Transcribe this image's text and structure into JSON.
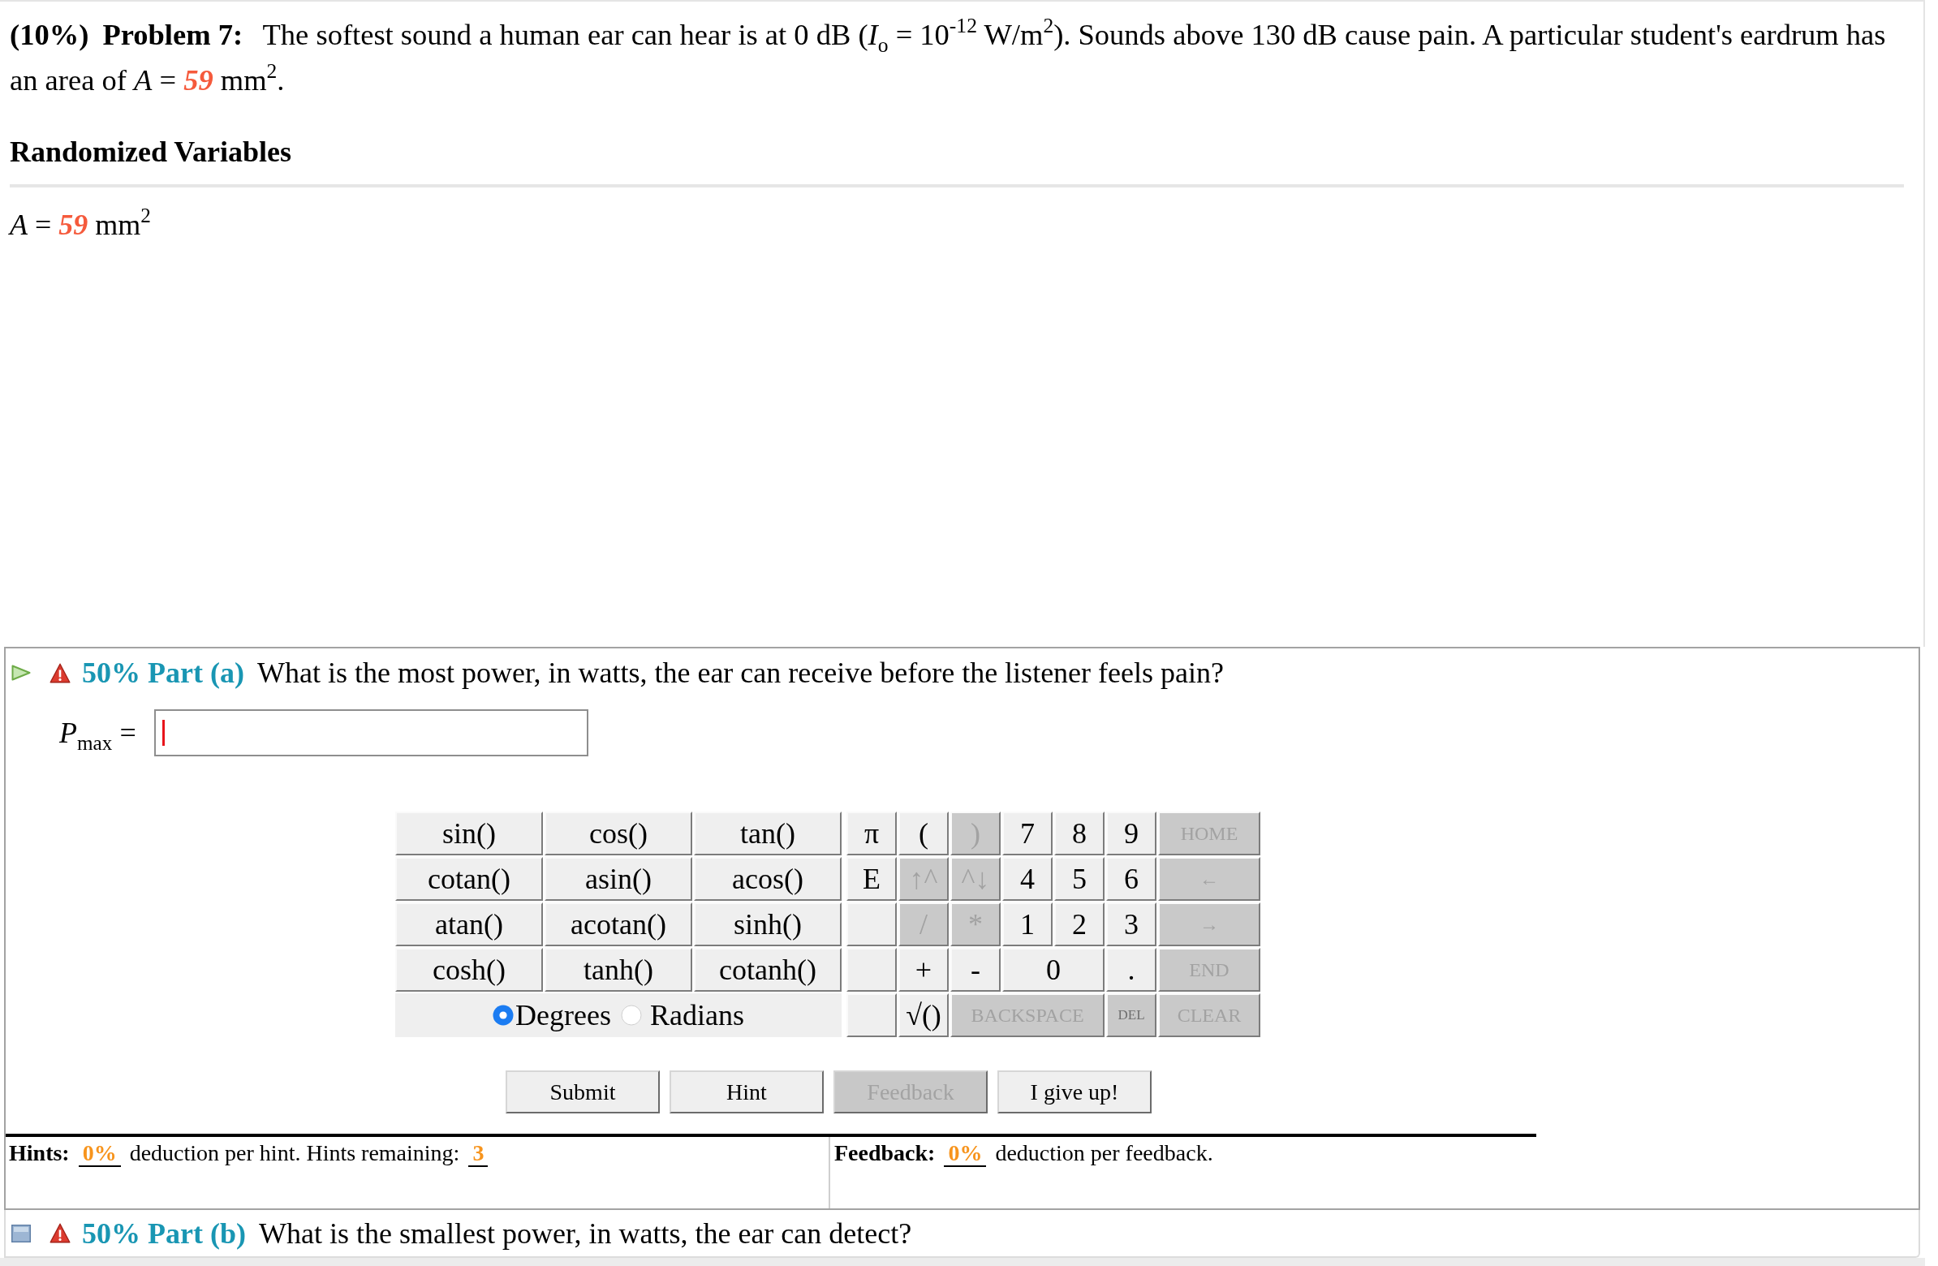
{
  "problem": {
    "weight": "(10%)",
    "title": "Problem 7:",
    "text_before": "The softest sound a human ear can hear is at 0 dB (*I*$_{o}$ = 10$^{-12}$ W/m$^{2}$). Sounds above 130 dB cause pain. A particular student's eardrum has an area of *A* = ",
    "value": "59",
    "text_after": " mm$^{2}$."
  },
  "randomized_variables": {
    "heading": "Randomized Variables",
    "items": [
      {
        "symbol": "*A* =",
        "value": "59",
        "unit": "mm$^{2}$"
      }
    ]
  },
  "parts": [
    {
      "expanded": true,
      "title": "50% Part (a)",
      "question": "What is the most power, in watts, the ear can receive before the listener feels pain?",
      "answer": {
        "label": "*P*$_{max}$ =",
        "focused": true
      },
      "keypad": {
        "functions": [
          [
            "sin()",
            "cos()",
            "tan()"
          ],
          [
            "cotan()",
            "asin()",
            "acos()"
          ],
          [
            "atan()",
            "acotan()",
            "sinh()"
          ],
          [
            "cosh()",
            "tanh()",
            "cotanh()"
          ]
        ],
        "angle_modes": [
          {
            "label": "Degrees",
            "selected": true
          },
          {
            "label": "Radians",
            "selected": false
          }
        ],
        "keys": [
          [
            {
              "kind": "key",
              "label": "π",
              "disabled": false
            },
            {
              "kind": "key",
              "label": "(",
              "disabled": false
            },
            {
              "kind": "key",
              "label": ")",
              "disabled": true
            },
            {
              "kind": "key",
              "label": "7",
              "disabled": false
            },
            {
              "kind": "key",
              "label": "8",
              "disabled": false
            },
            {
              "kind": "key",
              "label": "9",
              "disabled": false
            },
            {
              "kind": "wide",
              "label": "HOME",
              "disabled": true
            }
          ],
          [
            {
              "kind": "key",
              "label": "E",
              "disabled": false
            },
            {
              "kind": "key",
              "label": "↑^",
              "disabled": true
            },
            {
              "kind": "key",
              "label": "^↓",
              "disabled": true
            },
            {
              "kind": "key",
              "label": "4",
              "disabled": false
            },
            {
              "kind": "key",
              "label": "5",
              "disabled": false
            },
            {
              "kind": "key",
              "label": "6",
              "disabled": false
            },
            {
              "kind": "wide",
              "label": "←",
              "disabled": true
            }
          ],
          [
            {
              "kind": "blank",
              "disabled": false
            },
            {
              "kind": "key",
              "label": "/",
              "disabled": true
            },
            {
              "kind": "key",
              "label": "*",
              "disabled": true
            },
            {
              "kind": "key",
              "label": "1",
              "disabled": false
            },
            {
              "kind": "key",
              "label": "2",
              "disabled": false
            },
            {
              "kind": "key",
              "label": "3",
              "disabled": false
            },
            {
              "kind": "wide",
              "label": "→",
              "disabled": true
            }
          ],
          [
            {
              "kind": "blank",
              "disabled": false
            },
            {
              "kind": "key",
              "label": "+",
              "disabled": false
            },
            {
              "kind": "key",
              "label": "-",
              "disabled": false
            },
            {
              "kind": "wide",
              "label": "0",
              "disabled": false
            },
            {
              "kind": "key",
              "label": ".",
              "disabled": false
            },
            {
              "kind": "wide",
              "label": "END",
              "disabled": true
            }
          ],
          [
            {
              "kind": "blank",
              "disabled": false
            },
            {
              "kind": "key",
              "label": "√()",
              "disabled": false
            },
            {
              "kind": "wider",
              "label": "BACKSPACE",
              "disabled": true
            },
            {
              "kind": "compact",
              "label": "DEL",
              "disabled": true
            },
            {
              "kind": "wide",
              "label": "CLEAR",
              "disabled": true
            }
          ]
        ]
      },
      "buttons": [
        {
          "label": "Submit",
          "disabled": false
        },
        {
          "label": "Hint",
          "disabled": false
        },
        {
          "label": "Feedback",
          "disabled": true
        },
        {
          "label": "I give up!",
          "disabled": false
        }
      ],
      "hints": {
        "label": "Hints:",
        "deduction": "0%",
        "text": "deduction per hint. Hints remaining:",
        "remaining": "3"
      },
      "feedback": {
        "label": "Feedback:",
        "deduction": "0%",
        "text": "deduction per feedback."
      }
    },
    {
      "expanded": false,
      "title": "50% Part (b)",
      "question": "What is the smallest power, in watts, the ear can detect?"
    }
  ]
}
